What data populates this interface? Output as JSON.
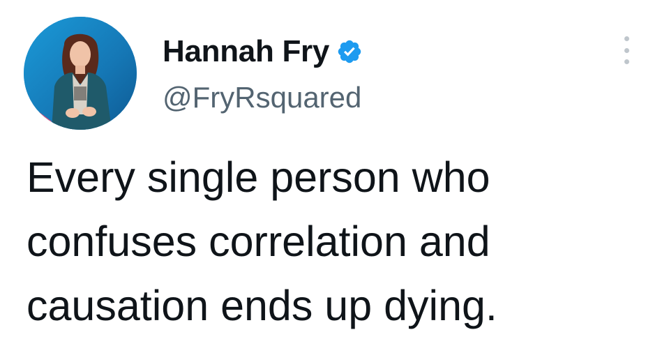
{
  "tweet": {
    "author": {
      "display_name": "Hannah Fry",
      "handle": "@FryRsquared",
      "verified": true,
      "verified_icon": "verified-badge-icon",
      "avatar": "profile-photo"
    },
    "more_menu_icon": "more-options-icon",
    "text_lines": [
      "Every single person who",
      "confuses correlation and",
      "causation ends up dying."
    ]
  },
  "colors": {
    "text": "#0f1419",
    "handle": "#536471",
    "verified": "#1d9bf0",
    "more_dots": "#bfc6cc"
  }
}
